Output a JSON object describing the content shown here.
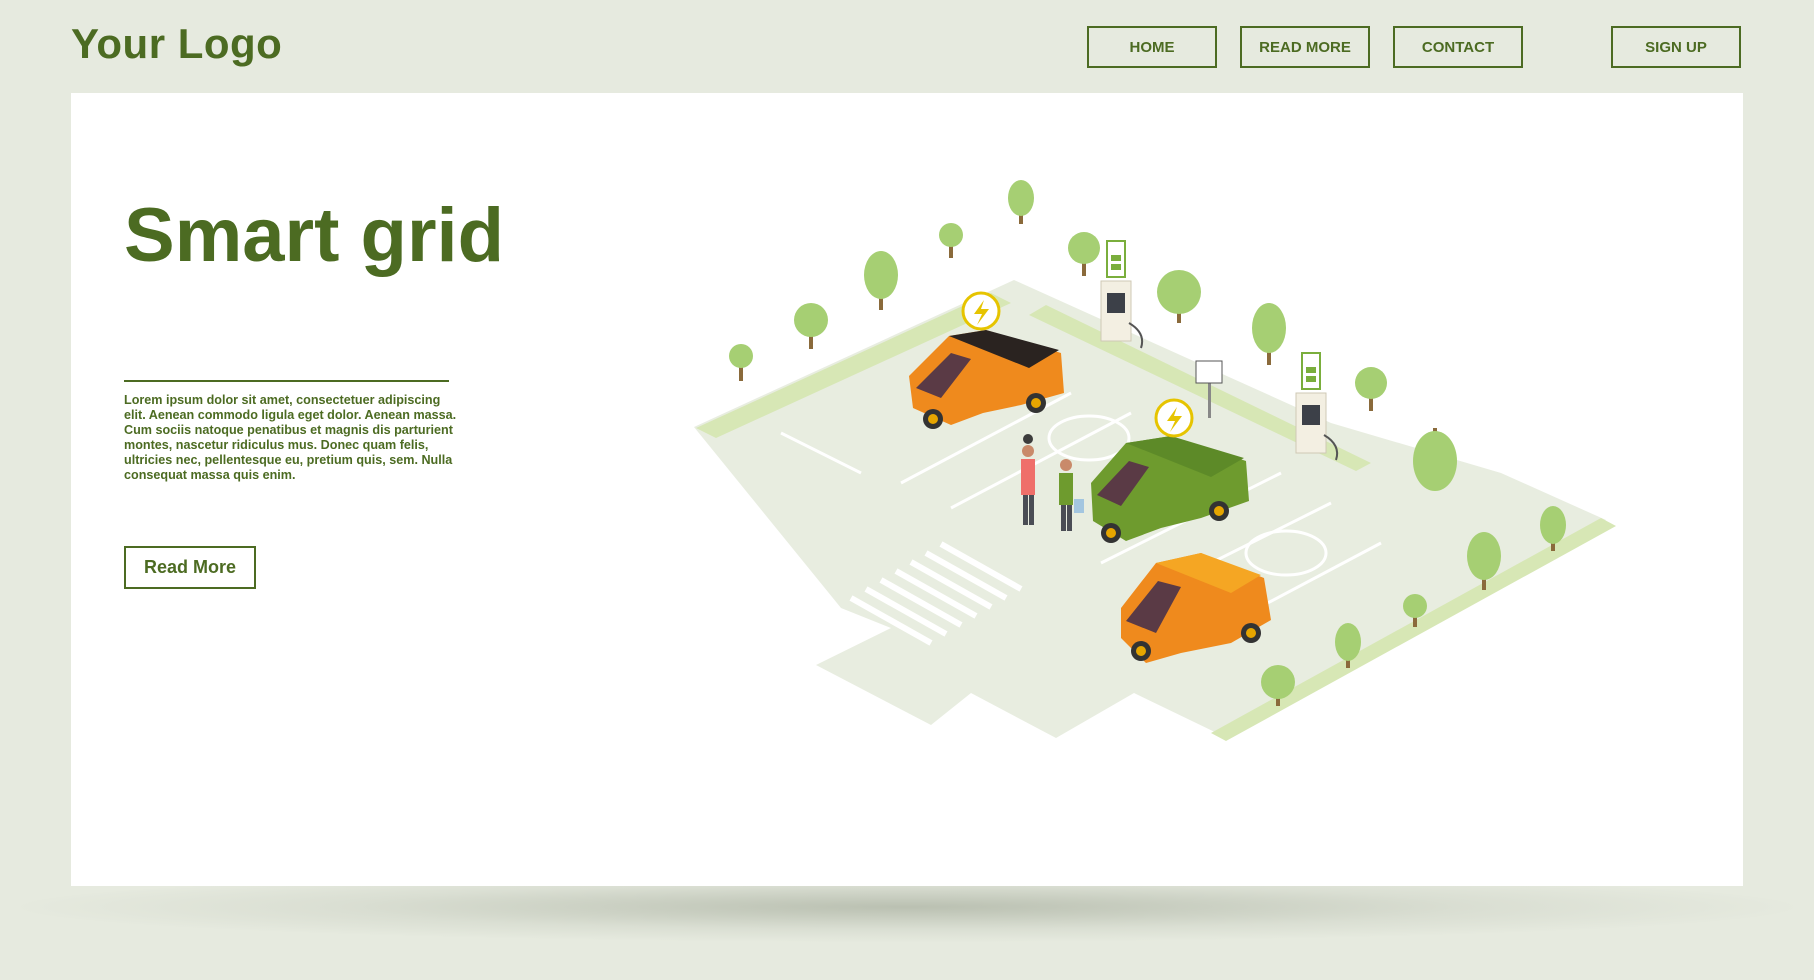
{
  "header": {
    "logo": "Your Logo",
    "nav": {
      "home": "HOME",
      "read_more": "READ MORE",
      "contact": "CONTACT",
      "sign_up": "SIGN UP"
    }
  },
  "hero": {
    "title": "Smart grid",
    "body": "Lorem ipsum dolor sit amet, consectetuer adipiscing elit. Aenean commodo ligula eget dolor. Aenean massa. Cum sociis natoque penatibus et magnis dis parturient montes, nascetur ridiculus mus. Donec quam felis, ultricies nec, pellentesque eu, pretium quis, sem. Nulla consequat massa quis enim.",
    "button": "Read More"
  },
  "illustration": {
    "subject": "electric-car-charging-parking",
    "cars": [
      "orange-black-car",
      "green-car",
      "orange-car"
    ]
  },
  "colors": {
    "brand": "#4c6b22",
    "background": "#e6eadf",
    "card": "#ffffff",
    "pavement": "#e8ede0",
    "grass": "#d7e7b5",
    "tree": "#a6cf73",
    "car_orange": "#ef8a1d",
    "car_green": "#6e9b2e"
  }
}
